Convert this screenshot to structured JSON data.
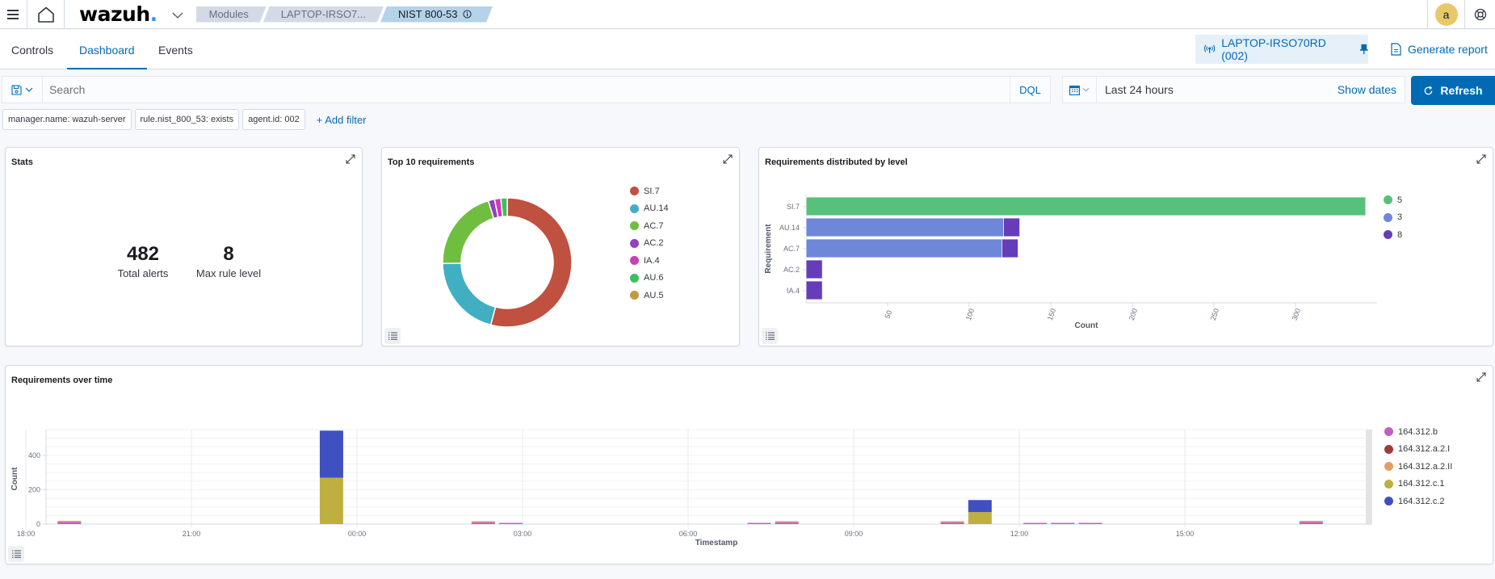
{
  "header": {
    "logo_text": "wazuh",
    "logo_dot": ".",
    "breadcrumbs": [
      "Modules",
      "LAPTOP-IRSO7...",
      "NIST 800-53"
    ],
    "avatar_initial": "a",
    "icons": {
      "menu": "hamburger-icon",
      "home": "home-icon",
      "logo_menu": "chevron-down-icon",
      "info": "info-icon",
      "help": "help-icon"
    }
  },
  "tabs": [
    {
      "label": "Controls",
      "active": false
    },
    {
      "label": "Dashboard",
      "active": true
    },
    {
      "label": "Events",
      "active": false
    }
  ],
  "agent": {
    "label": "LAPTOP-IRSO70RD (002)"
  },
  "generate_report": "Generate report",
  "search": {
    "placeholder": "Search",
    "value": "",
    "language": "DQL"
  },
  "date": {
    "range": "Last 24 hours",
    "show_dates": "Show dates"
  },
  "refresh": "Refresh",
  "filters": [
    "manager.name: wazuh-server",
    "rule.nist_800_53: exists",
    "agent.id: 002"
  ],
  "add_filter": "+ Add filter",
  "stats_panel": {
    "title": "Stats",
    "total_alerts": {
      "value": "482",
      "label": "Total alerts"
    },
    "max_rule_level": {
      "value": "8",
      "label": "Max rule level"
    }
  },
  "chart_data": [
    {
      "type": "pie",
      "title": "Top 10 requirements",
      "donut": true,
      "legend_position": "right",
      "labels": [
        "SI.7",
        "AU.14",
        "AC.7",
        "AC.2",
        "IA.4",
        "AU.6",
        "AU.5"
      ],
      "values": [
        343,
        131,
        130,
        10,
        10,
        10,
        0
      ],
      "colors": [
        "#C0503F",
        "#40AFC1",
        "#70BE40",
        "#9141C1",
        "#C641B1",
        "#3EBE5C",
        "#C19A40"
      ]
    },
    {
      "type": "bar",
      "orientation": "horizontal",
      "stacked": true,
      "title": "Requirements distributed by level",
      "xlabel": "Count",
      "ylabel": "Requirement",
      "categories": [
        "SI.7",
        "AU.14",
        "AC.7",
        "AC.2",
        "IA.4"
      ],
      "series": [
        {
          "name": "5",
          "color": "#57C17B",
          "values": [
            343,
            0,
            0,
            0,
            0
          ]
        },
        {
          "name": "3",
          "color": "#6F87D8",
          "values": [
            0,
            121,
            120,
            0,
            0
          ]
        },
        {
          "name": "8",
          "color": "#663DB8",
          "values": [
            0,
            10,
            10,
            10,
            10
          ]
        }
      ],
      "xlim": [
        0,
        350
      ],
      "xticks": [
        50,
        100,
        150,
        200,
        250,
        300
      ],
      "legend_position": "right"
    },
    {
      "type": "bar",
      "stacked": true,
      "title": "Requirements over time",
      "xlabel": "Timestamp",
      "ylabel": "Count",
      "x": [
        "19:00",
        "00:00",
        "02:30",
        "03:00",
        "07:30",
        "08:00",
        "11:00",
        "11:30",
        "12:30",
        "13:00",
        "13:30",
        "17:30"
      ],
      "x_hours": [
        19.0,
        23.75,
        2.5,
        3.0,
        7.5,
        8.0,
        11.0,
        11.5,
        12.5,
        13.0,
        13.5,
        17.5
      ],
      "series": [
        {
          "name": "164.312.b",
          "color": "#C15FC1",
          "values": [
            12,
            0,
            10,
            2,
            6,
            10,
            10,
            0,
            2,
            5,
            3,
            12
          ]
        },
        {
          "name": "164.312.a.2.I",
          "color": "#A33A3A",
          "values": [
            0,
            0,
            0,
            0,
            0,
            0,
            0,
            0,
            0,
            0,
            0,
            0
          ]
        },
        {
          "name": "164.312.a.2.II",
          "color": "#E0A060",
          "values": [
            5,
            0,
            4,
            0,
            0,
            4,
            3,
            0,
            0,
            0,
            0,
            3
          ]
        },
        {
          "name": "164.312.c.1",
          "color": "#BFAF40",
          "values": [
            0,
            270,
            0,
            0,
            0,
            0,
            0,
            70,
            0,
            0,
            0,
            0
          ]
        },
        {
          "name": "164.312.c.2",
          "color": "#4050C0",
          "values": [
            0,
            274,
            0,
            0,
            0,
            0,
            0,
            70,
            0,
            0,
            0,
            0
          ]
        }
      ],
      "xticks": [
        "21:00",
        "00:00",
        "03:00",
        "06:00",
        "09:00",
        "12:00",
        "15:00",
        "18:00"
      ],
      "yticks": [
        0,
        200,
        400
      ],
      "ylim": [
        0,
        550
      ],
      "legend_position": "right",
      "grid": true
    }
  ]
}
